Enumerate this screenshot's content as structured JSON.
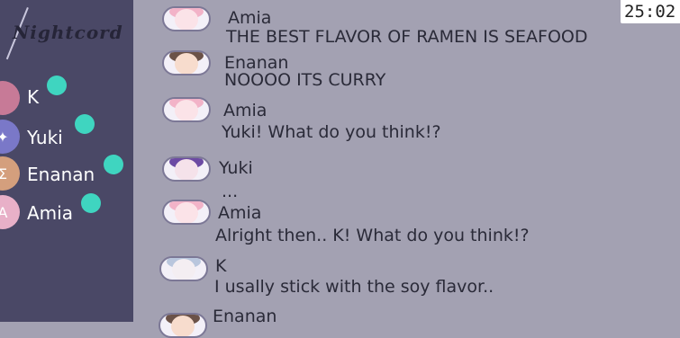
{
  "app": {
    "logo": "Nightcord",
    "timer": "25:02"
  },
  "sidebar": {
    "members": [
      {
        "name": "K",
        "avatar_glyph": "",
        "avatar_color": "#c77a97",
        "online": true
      },
      {
        "name": "Yuki",
        "avatar_glyph": "✦",
        "avatar_color": "#7a78c8",
        "online": true
      },
      {
        "name": "Enanan",
        "avatar_glyph": "Σ",
        "avatar_color": "#d49f7d",
        "online": true
      },
      {
        "name": "Amia",
        "avatar_glyph": "A",
        "avatar_color": "#e8b0c8",
        "online": true
      }
    ]
  },
  "chat": {
    "messages": [
      {
        "sender": "Amia",
        "text": "THE BEST FLAVOR OF RAMEN IS SEAFOOD",
        "avatar": "amia-avatar"
      },
      {
        "sender": "Enanan",
        "text": "NOOOO ITS CURRY",
        "avatar": "enanan-avatar"
      },
      {
        "sender": "Amia",
        "text": "Yuki! What do you think!?",
        "avatar": "amia-avatar"
      },
      {
        "sender": "Yuki",
        "text": "...",
        "avatar": "yuki-avatar"
      },
      {
        "sender": "Amia",
        "text": "Alright then.. K! What do you think!?",
        "avatar": "amia-avatar"
      },
      {
        "sender": "K",
        "text": "I usally stick with the soy flavor..",
        "avatar": "k-avatar"
      },
      {
        "sender": "Enanan",
        "text": "",
        "avatar": "enanan-avatar"
      }
    ]
  },
  "colors": {
    "background": "#a3a1b2",
    "sidebar": "#4a4866",
    "online_dot": "#3fd5c0",
    "amia_hair": "#f2b3c8",
    "enanan_hair": "#6b5248",
    "yuki_hair": "#6c4aa3",
    "k_hair": "#b9c6dd"
  }
}
